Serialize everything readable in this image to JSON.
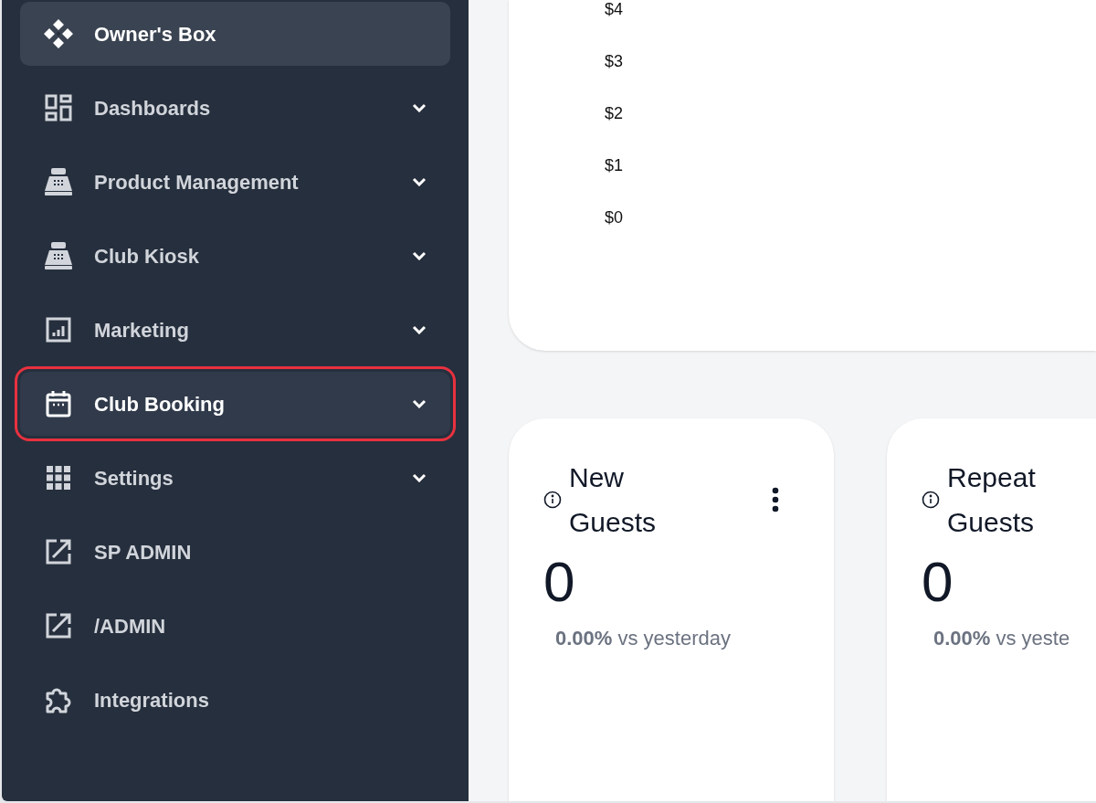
{
  "sidebar": {
    "items": [
      {
        "label": "Owner's Box",
        "selected": true,
        "highlighted": false,
        "expandable": false
      },
      {
        "label": "Dashboards",
        "selected": false,
        "highlighted": false,
        "expandable": true
      },
      {
        "label": "Product Management",
        "selected": false,
        "highlighted": false,
        "expandable": true
      },
      {
        "label": "Club Kiosk",
        "selected": false,
        "highlighted": false,
        "expandable": true
      },
      {
        "label": "Marketing",
        "selected": false,
        "highlighted": false,
        "expandable": true
      },
      {
        "label": "Club Booking",
        "selected": true,
        "highlighted": true,
        "expandable": true
      },
      {
        "label": "Settings",
        "selected": false,
        "highlighted": false,
        "expandable": true
      },
      {
        "label": "SP ADMIN",
        "selected": false,
        "highlighted": false,
        "expandable": false
      },
      {
        "label": "/ADMIN",
        "selected": false,
        "highlighted": false,
        "expandable": false
      },
      {
        "label": "Integrations",
        "selected": false,
        "highlighted": false,
        "expandable": false
      }
    ]
  },
  "chart": {
    "y_labels": [
      "$4",
      "$3",
      "$2",
      "$1",
      "$0"
    ]
  },
  "stat_cards": [
    {
      "title": "New Guests",
      "value": "0",
      "comparison": "**0.00%** vs yesterday",
      "menu": true
    },
    {
      "title": "Repeat Guests",
      "value": "0",
      "comparison": "**0.00%** vs yeste",
      "menu": false
    }
  ]
}
